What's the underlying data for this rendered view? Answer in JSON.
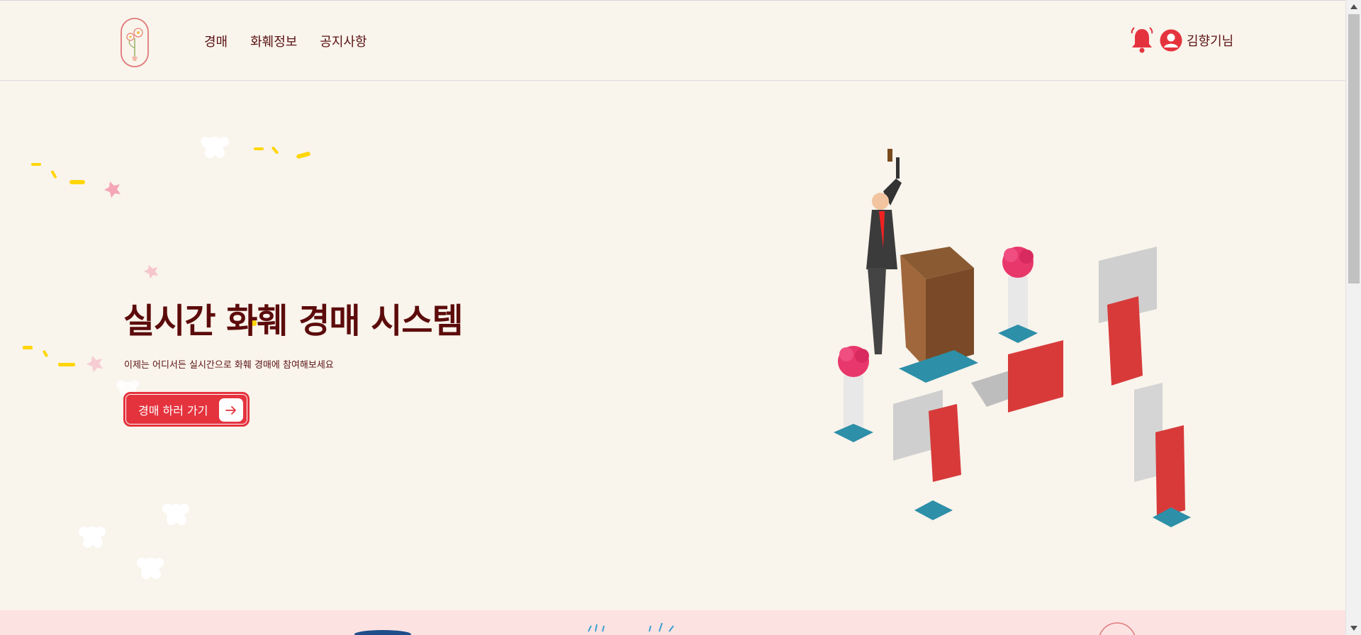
{
  "header": {
    "logo_icon": "flower-vase-logo",
    "nav": [
      {
        "label": "경매"
      },
      {
        "label": "화훼정보"
      },
      {
        "label": "공지사항"
      }
    ],
    "notification_icon": "bell-icon",
    "user_icon": "user-circle-icon",
    "user_name": "김향기님"
  },
  "hero": {
    "title": "실시간 화훼 경매 시스템",
    "subtitle": "이제는 어디서든 실시간으로 화훼 경매에 참여해보세요",
    "cta_label": "경매 하러 가기",
    "cta_icon": "arrow-right-icon",
    "illustration": "auction-room-illustration"
  },
  "colors": {
    "background": "#f9f4ec",
    "accent": "#e5333e",
    "title": "#5c0b0b",
    "band": "#fde2e2"
  }
}
